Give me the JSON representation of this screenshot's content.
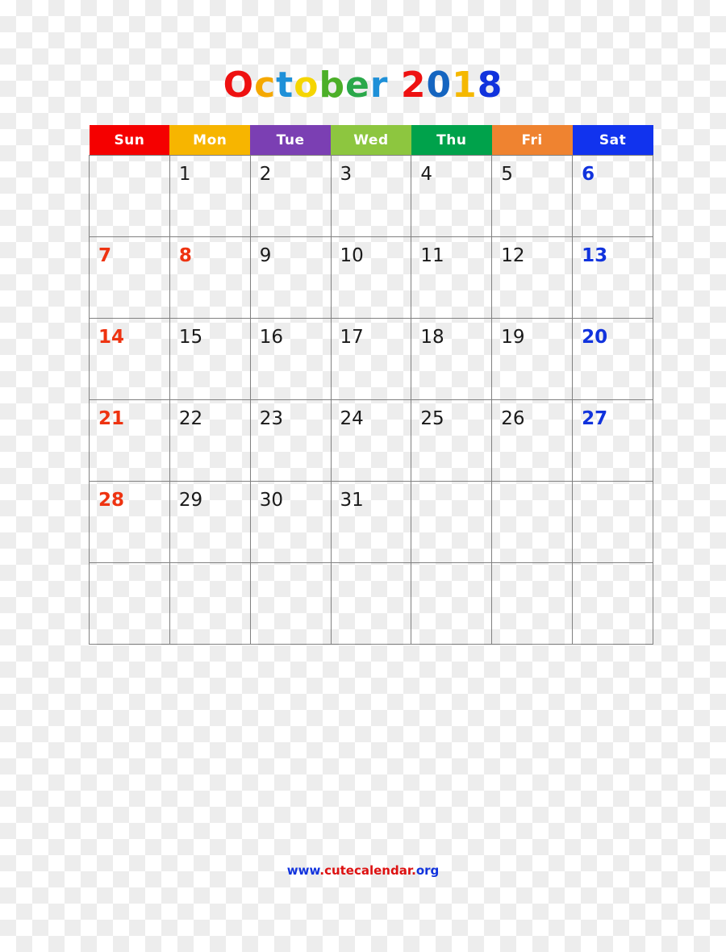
{
  "title": {
    "text": "October 2018",
    "month": "October",
    "year": "2018",
    "letters": [
      {
        "ch": "O",
        "color": "#ee1111"
      },
      {
        "ch": "c",
        "color": "#f5a800"
      },
      {
        "ch": "t",
        "color": "#1e90d8"
      },
      {
        "ch": "o",
        "color": "#f5d500"
      },
      {
        "ch": "b",
        "color": "#4caf28"
      },
      {
        "ch": "e",
        "color": "#2aa84a"
      },
      {
        "ch": "r",
        "color": "#1e90d8"
      },
      {
        "ch": " ",
        "color": "#000000"
      },
      {
        "ch": "2",
        "color": "#ee1111"
      },
      {
        "ch": "0",
        "color": "#1565c0"
      },
      {
        "ch": "1",
        "color": "#f5b800"
      },
      {
        "ch": "8",
        "color": "#1133dd"
      }
    ]
  },
  "weekdays": [
    {
      "label": "Sun",
      "bg": "#f50000",
      "fg": "#ffffff"
    },
    {
      "label": "Mon",
      "bg": "#f7b500",
      "fg": "#ffffff"
    },
    {
      "label": "Tue",
      "bg": "#7b3fb3",
      "fg": "#ffffff"
    },
    {
      "label": "Wed",
      "bg": "#8dc63f",
      "fg": "#ffffff"
    },
    {
      "label": "Thu",
      "bg": "#00a24b",
      "fg": "#ffffff"
    },
    {
      "label": "Fri",
      "bg": "#ef8330",
      "fg": "#ffffff"
    },
    {
      "label": "Sat",
      "bg": "#1133ee",
      "fg": "#ffffff"
    }
  ],
  "weeks": [
    [
      {
        "day": "",
        "kind": "empty"
      },
      {
        "day": "1",
        "kind": "weekday"
      },
      {
        "day": "2",
        "kind": "weekday"
      },
      {
        "day": "3",
        "kind": "weekday"
      },
      {
        "day": "4",
        "kind": "weekday"
      },
      {
        "day": "5",
        "kind": "weekday"
      },
      {
        "day": "6",
        "kind": "sat"
      }
    ],
    [
      {
        "day": "7",
        "kind": "sun"
      },
      {
        "day": "8",
        "kind": "holiday"
      },
      {
        "day": "9",
        "kind": "weekday"
      },
      {
        "day": "10",
        "kind": "weekday"
      },
      {
        "day": "11",
        "kind": "weekday"
      },
      {
        "day": "12",
        "kind": "weekday"
      },
      {
        "day": "13",
        "kind": "sat"
      }
    ],
    [
      {
        "day": "14",
        "kind": "sun"
      },
      {
        "day": "15",
        "kind": "weekday"
      },
      {
        "day": "16",
        "kind": "weekday"
      },
      {
        "day": "17",
        "kind": "weekday"
      },
      {
        "day": "18",
        "kind": "weekday"
      },
      {
        "day": "19",
        "kind": "weekday"
      },
      {
        "day": "20",
        "kind": "sat"
      }
    ],
    [
      {
        "day": "21",
        "kind": "sun"
      },
      {
        "day": "22",
        "kind": "weekday"
      },
      {
        "day": "23",
        "kind": "weekday"
      },
      {
        "day": "24",
        "kind": "weekday"
      },
      {
        "day": "25",
        "kind": "weekday"
      },
      {
        "day": "26",
        "kind": "weekday"
      },
      {
        "day": "27",
        "kind": "sat"
      }
    ],
    [
      {
        "day": "28",
        "kind": "sun"
      },
      {
        "day": "29",
        "kind": "weekday"
      },
      {
        "day": "30",
        "kind": "weekday"
      },
      {
        "day": "31",
        "kind": "weekday"
      },
      {
        "day": "",
        "kind": "empty"
      },
      {
        "day": "",
        "kind": "empty"
      },
      {
        "day": "",
        "kind": "empty"
      }
    ],
    [
      {
        "day": "",
        "kind": "empty"
      },
      {
        "day": "",
        "kind": "empty"
      },
      {
        "day": "",
        "kind": "empty"
      },
      {
        "day": "",
        "kind": "empty"
      },
      {
        "day": "",
        "kind": "empty"
      },
      {
        "day": "",
        "kind": "empty"
      },
      {
        "day": "",
        "kind": "empty"
      }
    ]
  ],
  "footer": {
    "text": "www.cutecalendar.org",
    "parts": [
      {
        "t": "www",
        "color": "#1133dd"
      },
      {
        "t": ".",
        "color": "#dd1111"
      },
      {
        "t": "cutecalendar",
        "color": "#dd1111"
      },
      {
        "t": ".",
        "color": "#dd1111"
      },
      {
        "t": "org",
        "color": "#1133dd"
      }
    ]
  },
  "colors": {
    "grid_line": "#808080",
    "weekday_text": "#1a1a1a",
    "sunday_text": "#ee3311",
    "saturday_text": "#1133dd"
  }
}
